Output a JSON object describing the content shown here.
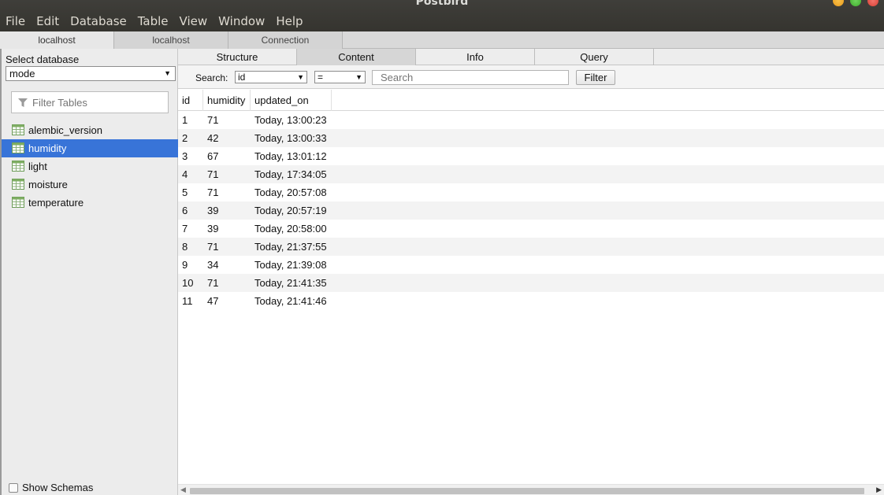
{
  "window": {
    "title": "Postbird"
  },
  "menu": [
    "File",
    "Edit",
    "Database",
    "Table",
    "View",
    "Window",
    "Help"
  ],
  "connection_tabs": [
    {
      "label": "localhost",
      "active": true
    },
    {
      "label": "localhost",
      "active": false
    },
    {
      "label": "Connection",
      "active": false
    }
  ],
  "sidebar": {
    "select_database_label": "Select database",
    "database": "mode",
    "filter_placeholder": "Filter Tables",
    "tables": [
      "alembic_version",
      "humidity",
      "light",
      "moisture",
      "temperature"
    ],
    "selected_table": "humidity",
    "show_schemas_label": "Show Schemas"
  },
  "view_tabs": [
    {
      "label": "Structure",
      "active": false
    },
    {
      "label": "Content",
      "active": true
    },
    {
      "label": "Info",
      "active": false
    },
    {
      "label": "Query",
      "active": false
    }
  ],
  "search": {
    "label": "Search:",
    "field": "id",
    "operator": "=",
    "placeholder": "Search",
    "button": "Filter"
  },
  "grid": {
    "columns": [
      "id",
      "humidity",
      "updated_on"
    ],
    "rows": [
      [
        "1",
        "71",
        "Today, 13:00:23"
      ],
      [
        "2",
        "42",
        "Today, 13:00:33"
      ],
      [
        "3",
        "67",
        "Today, 13:01:12"
      ],
      [
        "4",
        "71",
        "Today, 17:34:05"
      ],
      [
        "5",
        "71",
        "Today, 20:57:08"
      ],
      [
        "6",
        "39",
        "Today, 20:57:19"
      ],
      [
        "7",
        "39",
        "Today, 20:58:00"
      ],
      [
        "8",
        "71",
        "Today, 21:37:55"
      ],
      [
        "9",
        "34",
        "Today, 21:39:08"
      ],
      [
        "10",
        "71",
        "Today, 21:41:35"
      ],
      [
        "11",
        "47",
        "Today, 21:41:46"
      ]
    ]
  },
  "colors": {
    "selection": "#3874d8",
    "titlebar": "#3c3b37"
  }
}
